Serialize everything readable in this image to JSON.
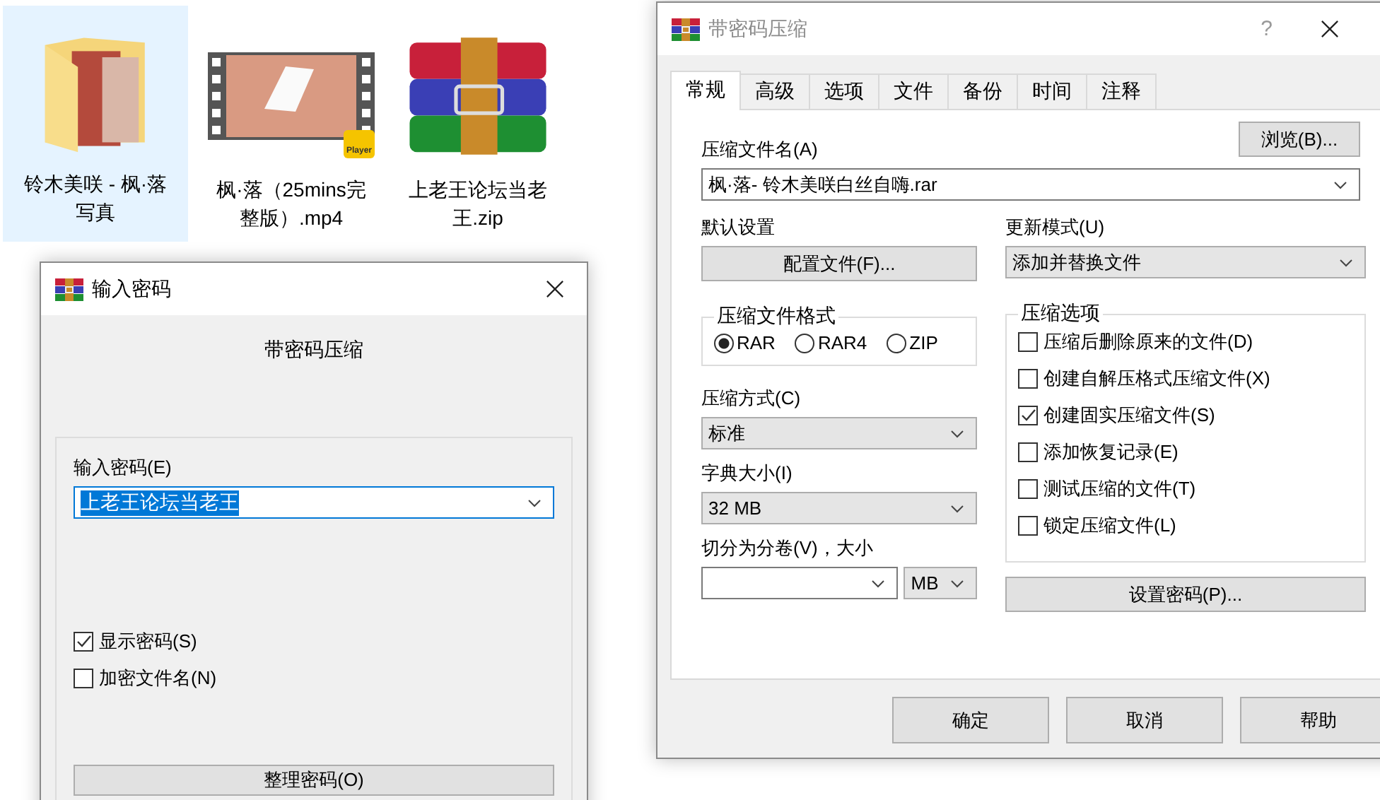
{
  "desktop_items": [
    {
      "kind": "folder",
      "label": "铃木美咲 - 枫·落写真",
      "selected": true
    },
    {
      "kind": "video",
      "label": "枫·落（25mins完整版）.mp4",
      "badge": "Player",
      "selected": false
    },
    {
      "kind": "archive",
      "label": "上老王论坛当老王.zip",
      "selected": false
    }
  ],
  "password_dialog": {
    "title": "输入密码",
    "heading": "带密码压缩",
    "password_label": "输入密码(E)",
    "password_value": "上老王论坛当老王",
    "options": [
      {
        "label": "显示密码(S)",
        "checked": true
      },
      {
        "label": "加密文件名(N)",
        "checked": false
      }
    ],
    "organize_button": "整理密码(O)"
  },
  "compress_dialog": {
    "title": "带密码压缩",
    "help_glyph": "?",
    "tabs": [
      {
        "label": "常规",
        "selected": true
      },
      {
        "label": "高级",
        "selected": false
      },
      {
        "label": "选项",
        "selected": false
      },
      {
        "label": "文件",
        "selected": false
      },
      {
        "label": "备份",
        "selected": false
      },
      {
        "label": "时间",
        "selected": false
      },
      {
        "label": "注释",
        "selected": false
      }
    ],
    "archive_name_label": "压缩文件名(A)",
    "browse_button": "浏览(B)...",
    "archive_name": "枫·落- 铃木美咲白丝自嗨.rar",
    "default_settings_label": "默认设置",
    "profiles_button": "配置文件(F)...",
    "update_mode_label": "更新模式(U)",
    "update_mode": "添加并替换文件",
    "format_group": {
      "title": "压缩文件格式",
      "options": [
        {
          "label": "RAR",
          "selected": true
        },
        {
          "label": "RAR4",
          "selected": false
        },
        {
          "label": "ZIP",
          "selected": false
        }
      ]
    },
    "method_label": "压缩方式(C)",
    "method": "标准",
    "dictionary_label": "字典大小(I)",
    "dictionary": "32 MB",
    "split_label": "切分为分卷(V)，大小",
    "split_unit": "MB",
    "options_group": {
      "title": "压缩选项",
      "options": [
        {
          "label": "压缩后删除原来的文件(D)",
          "checked": false
        },
        {
          "label": "创建自解压格式压缩文件(X)",
          "checked": false
        },
        {
          "label": "创建固实压缩文件(S)",
          "checked": true
        },
        {
          "label": "添加恢复记录(E)",
          "checked": false
        },
        {
          "label": "测试压缩的文件(T)",
          "checked": false
        },
        {
          "label": "锁定压缩文件(L)",
          "checked": false
        }
      ]
    },
    "set_password_button": "设置密码(P)...",
    "buttons": [
      "确定",
      "取消",
      "帮助"
    ]
  }
}
